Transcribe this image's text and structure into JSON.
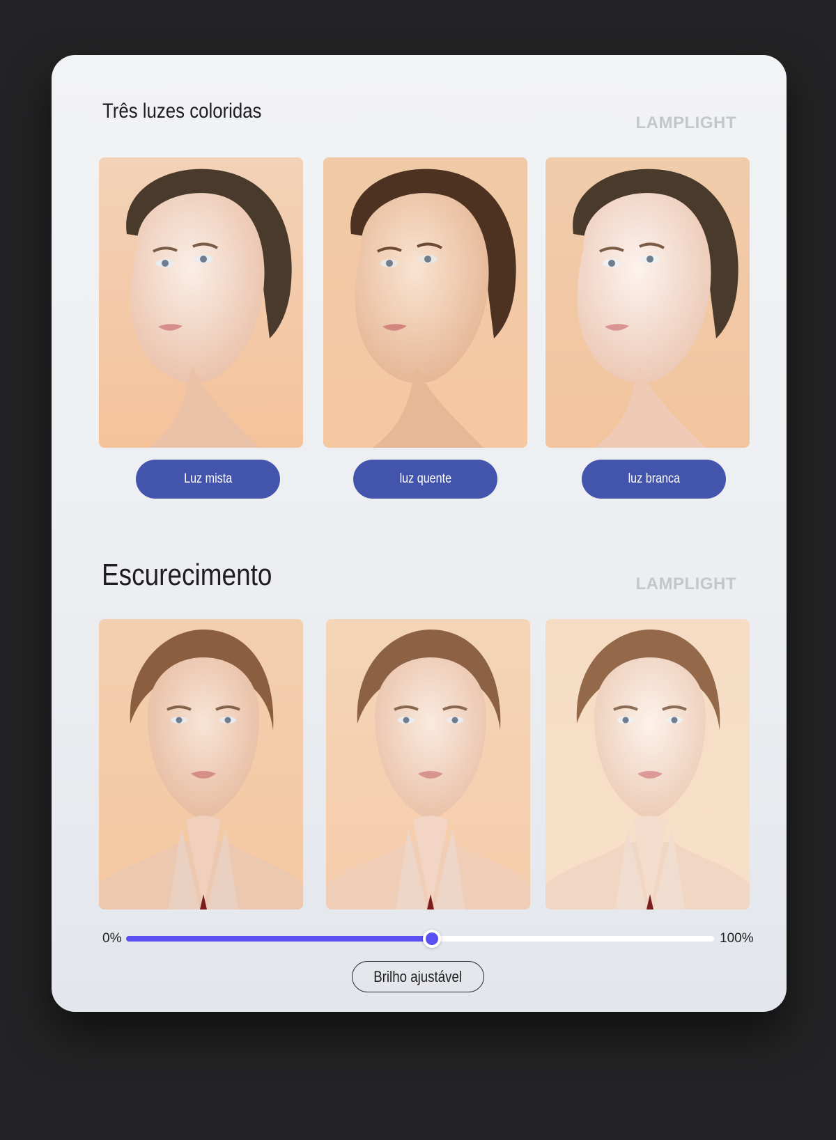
{
  "section1": {
    "title": "Três luzes coloridas",
    "brand": "LAMPLIGHT",
    "buttons": [
      "Luz mista",
      "luz quente",
      "luz branca"
    ]
  },
  "section2": {
    "title": "Escurecimento",
    "brand": "LAMPLIGHT"
  },
  "slider": {
    "min_label": "0%",
    "max_label": "100%",
    "value_fraction": 0.52,
    "button_label": "Brilho ajustável"
  },
  "colors": {
    "accent": "#4354ad",
    "slider_fill": "#5a4ff0",
    "background": "#232325",
    "card": "#eef0f3",
    "photo_bg": "#f2c8a4"
  },
  "images": {
    "section1": [
      "portrait-three-quarter-mixed-light",
      "portrait-three-quarter-warm-light",
      "portrait-three-quarter-white-light"
    ],
    "section2": [
      "portrait-front-hands-dim",
      "portrait-front-hands-medium",
      "portrait-front-hands-bright"
    ]
  }
}
